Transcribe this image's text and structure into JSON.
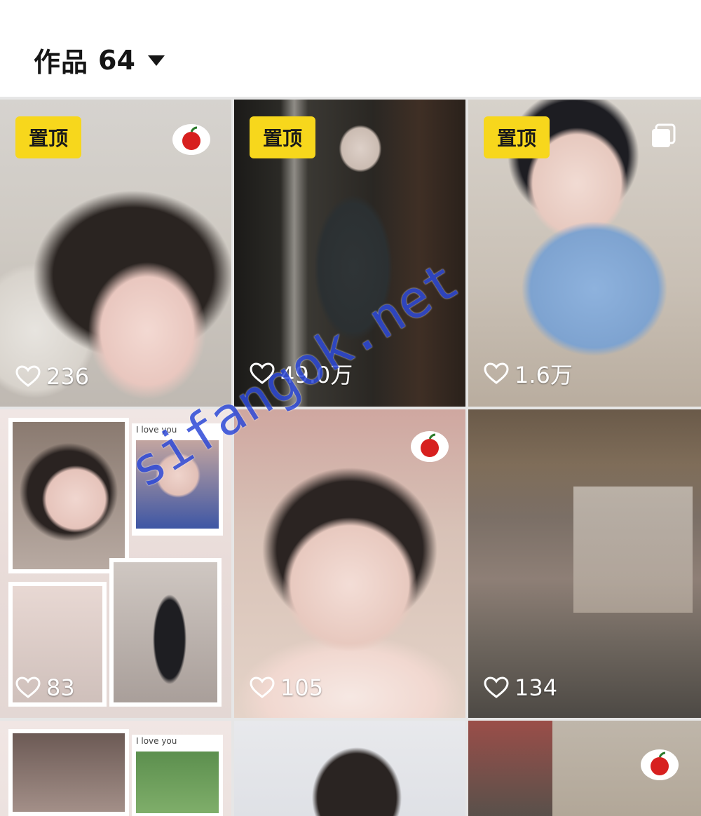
{
  "header": {
    "works_label": "作品",
    "works_count": "64"
  },
  "pin_label": "置顶",
  "tiles": [
    {
      "likes": "236",
      "pinned": true,
      "sticker": "apple-sticker-icon"
    },
    {
      "likes": "49.0万",
      "pinned": true
    },
    {
      "likes": "1.6万",
      "pinned": true,
      "multi_image": true
    },
    {
      "likes": "83",
      "collage_notes": [
        "I love you"
      ]
    },
    {
      "likes": "105",
      "sticker": "apple-sticker-icon"
    },
    {
      "likes": "134"
    },
    {
      "collage_notes": [
        "I love you"
      ]
    },
    {},
    {
      "sticker": "apple-sticker-icon"
    }
  ],
  "watermark": "sifangok.net",
  "colors": {
    "pin_badge": "#f7d71c",
    "watermark": "#2e4ad8",
    "like_text": "#ffffff"
  }
}
